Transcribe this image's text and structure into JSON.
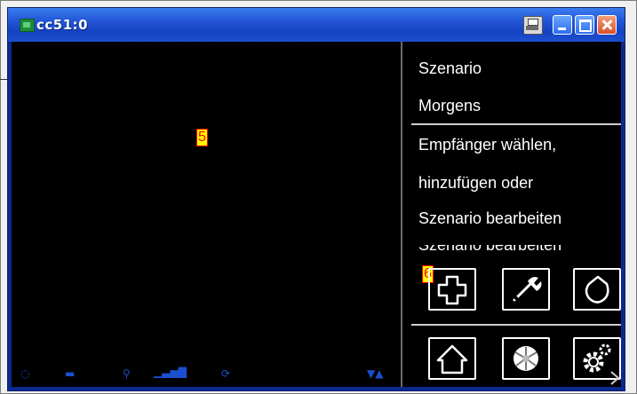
{
  "window": {
    "title": "cc51:0"
  },
  "markers": {
    "left_area": "5",
    "icon_area": "6"
  },
  "sidebar": {
    "scenario_label": "Szenario",
    "scenario_name": "Morgens",
    "instruction_lines": [
      "Empfänger wählen,",
      "hinzufügen oder",
      "Szenario bearbeiten"
    ],
    "clipped_text": "Szenario bearbeiten"
  },
  "toolbar_icons": {
    "row1": [
      "add-icon",
      "wrench-icon",
      "back-icon"
    ],
    "row2": [
      "home-icon",
      "fan-icon",
      "settings-gears-icon"
    ]
  },
  "colors": {
    "titlebar": "#2458d8",
    "background": "#000000",
    "text": "#ffffff",
    "marker": "#ffff00"
  }
}
